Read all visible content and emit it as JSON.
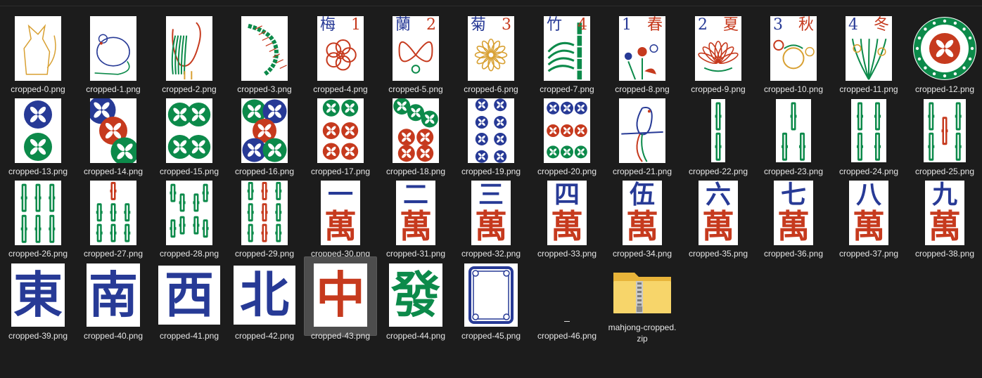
{
  "colors": {
    "red": "#c63a1e",
    "green": "#0c8a4a",
    "blue": "#273a96",
    "gold": "#d8a032"
  },
  "items": [
    {
      "name": "cropped-0.png",
      "kind": "image",
      "motif": "cat-icon"
    },
    {
      "name": "cropped-1.png",
      "kind": "image",
      "motif": "mouse-icon"
    },
    {
      "name": "cropped-2.png",
      "kind": "image",
      "motif": "rooster-icon"
    },
    {
      "name": "cropped-3.png",
      "kind": "image",
      "motif": "centipede-icon"
    },
    {
      "name": "cropped-4.png",
      "kind": "flower",
      "char": "梅",
      "num": "1",
      "numColor": "red",
      "motif": "plum-blossom-icon"
    },
    {
      "name": "cropped-5.png",
      "kind": "flower",
      "char": "蘭",
      "num": "2",
      "numColor": "red",
      "motif": "orchid-icon"
    },
    {
      "name": "cropped-6.png",
      "kind": "flower",
      "char": "菊",
      "num": "3",
      "numColor": "red",
      "motif": "chrysanthemum-icon"
    },
    {
      "name": "cropped-7.png",
      "kind": "flower",
      "char": "竹",
      "num": "4",
      "numColor": "red",
      "motif": "bamboo-plant-icon"
    },
    {
      "name": "cropped-8.png",
      "kind": "season",
      "char": "春",
      "num": "1",
      "motif": "spring-flowers-icon"
    },
    {
      "name": "cropped-9.png",
      "kind": "season",
      "char": "夏",
      "num": "2",
      "motif": "lotus-icon"
    },
    {
      "name": "cropped-10.png",
      "kind": "season",
      "char": "秋",
      "num": "3",
      "motif": "autumn-fruit-icon"
    },
    {
      "name": "cropped-11.png",
      "kind": "season",
      "char": "冬",
      "num": "4",
      "motif": "winter-plant-icon"
    },
    {
      "name": "cropped-12.png",
      "kind": "dot1",
      "motif": "one-circle-icon"
    },
    {
      "name": "cropped-13.png",
      "kind": "dots",
      "n": 2,
      "motif": "circles-icon"
    },
    {
      "name": "cropped-14.png",
      "kind": "dots",
      "n": 3,
      "motif": "circles-icon"
    },
    {
      "name": "cropped-15.png",
      "kind": "dots",
      "n": 4,
      "motif": "circles-icon"
    },
    {
      "name": "cropped-16.png",
      "kind": "dots",
      "n": 5,
      "motif": "circles-icon"
    },
    {
      "name": "cropped-17.png",
      "kind": "dots",
      "n": 6,
      "motif": "circles-icon"
    },
    {
      "name": "cropped-18.png",
      "kind": "dots",
      "n": 7,
      "motif": "circles-icon"
    },
    {
      "name": "cropped-19.png",
      "kind": "dots",
      "n": 8,
      "motif": "circles-icon"
    },
    {
      "name": "cropped-20.png",
      "kind": "dots",
      "n": 9,
      "motif": "circles-icon"
    },
    {
      "name": "cropped-21.png",
      "kind": "image",
      "motif": "bird-icon"
    },
    {
      "name": "cropped-22.png",
      "kind": "bamboo",
      "n": 2,
      "motif": "bamboo-sticks-icon"
    },
    {
      "name": "cropped-23.png",
      "kind": "bamboo",
      "n": 3,
      "motif": "bamboo-sticks-icon"
    },
    {
      "name": "cropped-24.png",
      "kind": "bamboo",
      "n": 4,
      "motif": "bamboo-sticks-icon"
    },
    {
      "name": "cropped-25.png",
      "kind": "bamboo",
      "n": 5,
      "motif": "bamboo-sticks-icon"
    },
    {
      "name": "cropped-26.png",
      "kind": "bamboo",
      "n": 6,
      "motif": "bamboo-sticks-icon"
    },
    {
      "name": "cropped-27.png",
      "kind": "bamboo",
      "n": 7,
      "motif": "bamboo-sticks-icon"
    },
    {
      "name": "cropped-28.png",
      "kind": "bamboo",
      "n": 8,
      "motif": "bamboo-sticks-icon"
    },
    {
      "name": "cropped-29.png",
      "kind": "bamboo",
      "n": 9,
      "motif": "bamboo-sticks-icon"
    },
    {
      "name": "cropped-30.png",
      "kind": "wan",
      "num": "一",
      "top": "一",
      "bottom": "萬",
      "motif": "character-tile-icon"
    },
    {
      "name": "cropped-31.png",
      "kind": "wan",
      "num": "二",
      "top": "二",
      "bottom": "萬",
      "motif": "character-tile-icon"
    },
    {
      "name": "cropped-32.png",
      "kind": "wan",
      "num": "三",
      "top": "三",
      "bottom": "萬",
      "motif": "character-tile-icon"
    },
    {
      "name": "cropped-33.png",
      "kind": "wan",
      "num": "四",
      "top": "四",
      "bottom": "萬",
      "motif": "character-tile-icon"
    },
    {
      "name": "cropped-34.png",
      "kind": "wan",
      "num": "伍",
      "top": "伍",
      "bottom": "萬",
      "motif": "character-tile-icon"
    },
    {
      "name": "cropped-35.png",
      "kind": "wan",
      "num": "六",
      "top": "六",
      "bottom": "萬",
      "motif": "character-tile-icon"
    },
    {
      "name": "cropped-36.png",
      "kind": "wan",
      "num": "七",
      "top": "七",
      "bottom": "萬",
      "motif": "character-tile-icon"
    },
    {
      "name": "cropped-37.png",
      "kind": "wan",
      "num": "八",
      "top": "八",
      "bottom": "萬",
      "motif": "character-tile-icon"
    },
    {
      "name": "cropped-38.png",
      "kind": "wan",
      "num": "九",
      "top": "九",
      "bottom": "萬",
      "motif": "character-tile-icon"
    },
    {
      "name": "cropped-39.png",
      "kind": "big",
      "char": "東",
      "color": "blue",
      "motif": "east-wind-icon"
    },
    {
      "name": "cropped-40.png",
      "kind": "big",
      "char": "南",
      "color": "blue",
      "motif": "south-wind-icon"
    },
    {
      "name": "cropped-41.png",
      "kind": "big",
      "char": "西",
      "color": "blue",
      "motif": "west-wind-icon"
    },
    {
      "name": "cropped-42.png",
      "kind": "big",
      "char": "北",
      "color": "blue",
      "motif": "north-wind-icon"
    },
    {
      "name": "cropped-43.png",
      "kind": "big",
      "char": "中",
      "color": "red",
      "motif": "red-dragon-icon",
      "selected": true
    },
    {
      "name": "cropped-44.png",
      "kind": "big",
      "char": "發",
      "color": "green",
      "motif": "green-dragon-icon"
    },
    {
      "name": "cropped-45.png",
      "kind": "frame",
      "motif": "white-dragon-icon"
    },
    {
      "name": "cropped-46.png",
      "kind": "blank",
      "motif": "blank-image-icon"
    },
    {
      "name": "mahjong-cropped.zip",
      "kind": "zip",
      "motif": "zip-folder-icon"
    }
  ]
}
